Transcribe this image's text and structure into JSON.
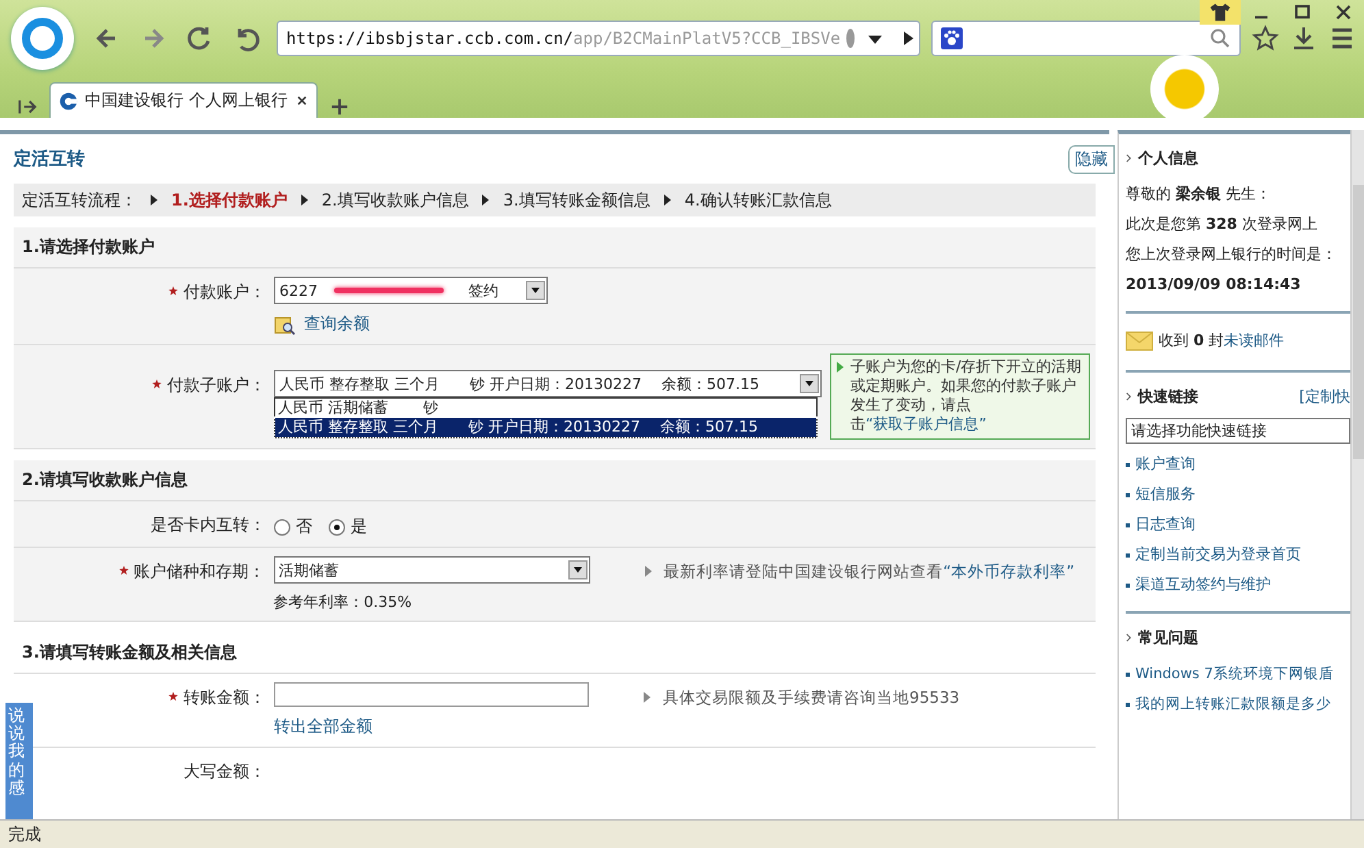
{
  "browser": {
    "url_host": "https://ibsbjstar.ccb.com.cn/",
    "url_path": "app/B2CMainPlatV5?CCB_IBSVe",
    "tab_title": "中国建设银行 个人网上银行",
    "tab_selected": true
  },
  "page": {
    "title": "定活互转",
    "hide_button": "隐藏",
    "steps_label": "定活互转流程：",
    "steps": [
      {
        "label": "1.选择付款账户",
        "selected": true
      },
      {
        "label": "2.填写收款账户信息",
        "selected": false
      },
      {
        "label": "3.填写转账金额信息",
        "selected": false
      },
      {
        "label": "4.确认转账汇款信息",
        "selected": false
      }
    ],
    "section1": {
      "title": "1.请选择付款账户",
      "account": {
        "label": "付款账户：",
        "required": true,
        "value_visible": "6227",
        "tag": "签约",
        "query_link": "查询余额"
      },
      "sub_account": {
        "label": "付款子账户：",
        "required": true,
        "value": "人民币 整存整取 三个月　　钞 开户日期：20130227　 余额：507.15",
        "options": [
          {
            "text": "人民币 活期储蓄　　 钞",
            "selected": false
          },
          {
            "text": "人民币 整存整取 三个月　　钞 开户日期：20130227　 余额：507.15",
            "selected": true
          }
        ],
        "tip": "子账户为您的卡/存折下开立的活期或定期账户。如果您的付款子账户发生了变动，请点击",
        "tip_link": "“获取子账户信息”"
      }
    },
    "section2": {
      "title": "2.请填写收款账户信息",
      "in_card": {
        "label": "是否卡内互转：",
        "options": [
          {
            "label": "否",
            "selected": false
          },
          {
            "label": "是",
            "selected": true
          }
        ]
      },
      "deposit": {
        "label": "账户储种和存期：",
        "required": true,
        "value": "活期储蓄",
        "rate": "参考年利率：0.35%",
        "tip": "最新利率请登陆中国建设银行网站查看",
        "tip_link": "“本外币存款利率”"
      }
    },
    "section3": {
      "title": "3.请填写转账金额及相关信息",
      "amount": {
        "label": "转账金额：",
        "required": true,
        "link": "转出全部金额",
        "tip": "具体交易限额及手续费请咨询当地95533"
      },
      "capital": {
        "label": "大写金额："
      }
    }
  },
  "sidebar": {
    "personal": {
      "title": "个人信息",
      "greeting_pre": "尊敬的",
      "name": "梁余银",
      "greeting_post": "先生：",
      "visits": "此次是您第 **328** 次登录网上",
      "last_login_label": "您上次登录网上银行的时间是：",
      "last_login": "2013/09/09 08:14:43"
    },
    "mail": {
      "pre": "收到",
      "count": "0",
      "mid": "封",
      "link": "未读邮件"
    },
    "quick": {
      "title": "快速链接",
      "custom": "[定制快",
      "select": "请选择功能快速链接",
      "links": [
        "账户查询",
        "短信服务",
        "日志查询",
        "定制当前交易为登录首页",
        "渠道互动签约与维护"
      ]
    },
    "faq": {
      "title": "常见问题",
      "links": [
        "Windows 7系统环境下网银盾",
        "我的网上转账汇款限额是多少"
      ]
    }
  },
  "feedback_tab": "说说我的感",
  "status_bar": "完成"
}
